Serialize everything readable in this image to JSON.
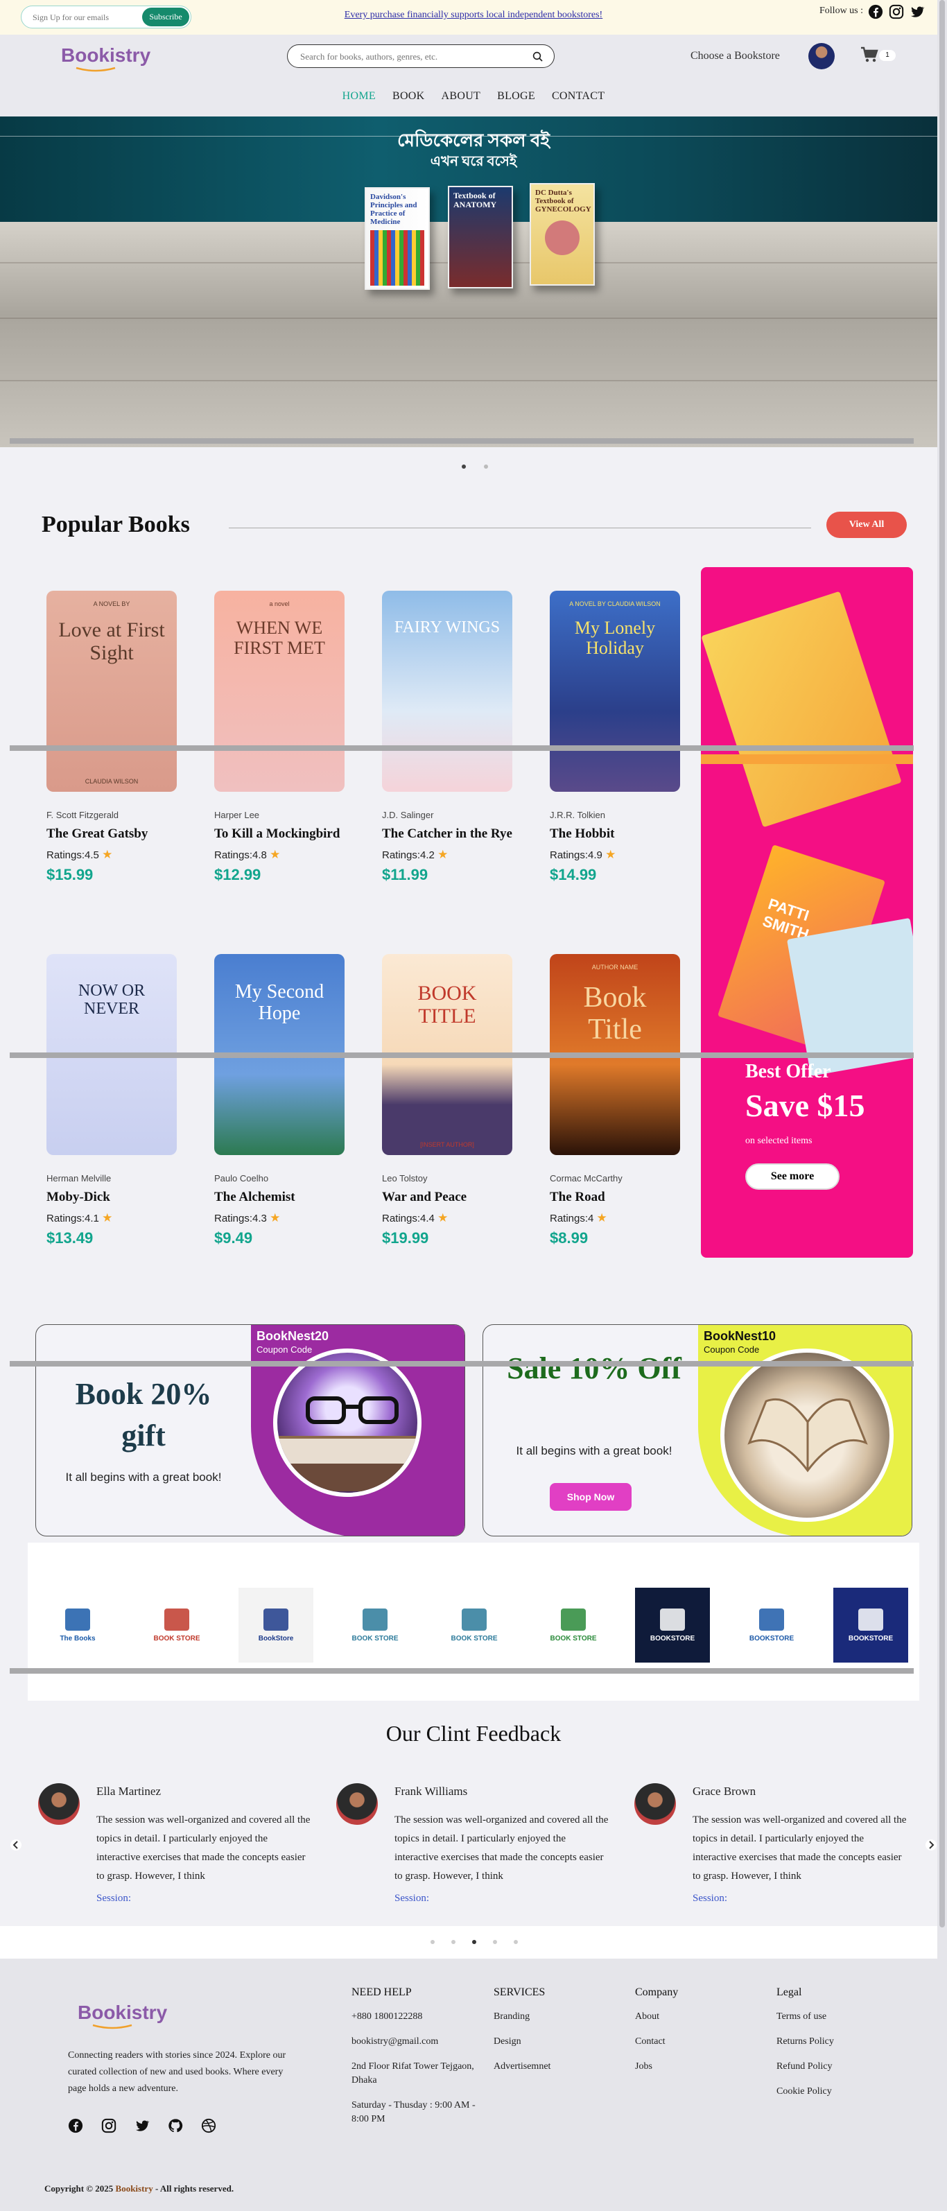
{
  "topbar": {
    "subscribe_placeholder": "Sign Up for our emails",
    "subscribe_button": "Subscribe",
    "promo": "Every purchase financially supports local independent bookstores!",
    "follow": "Follow us :"
  },
  "header": {
    "logo": "Bookistry",
    "search_placeholder": "Search for books, authors, genres, etc.",
    "choose_bookstore": "Choose a Bookstore",
    "cart_count": "1"
  },
  "nav": [
    "HOME",
    "BOOK",
    "ABOUT",
    "BLOGE",
    "CONTACT"
  ],
  "hero": {
    "line1": "মেডিকেলের সকল বই",
    "line2": "এখন ঘরে বসেই",
    "book_titles": [
      "Davidson's Principles and Practice of Medicine",
      "Textbook of ANATOMY",
      "DC Dutta's Textbook of GYNECOLOGY"
    ]
  },
  "popular": {
    "title": "Popular Books",
    "view_all": "View All",
    "rating_label": "Ratings:",
    "books": [
      {
        "author": "F. Scott Fitzgerald",
        "title": "The Great Gatsby",
        "rating": "4.5",
        "price": "$15.99",
        "cover_lines": [
          "A NOVEL BY",
          "Love at First Sight",
          "CLAUDIA WILSON"
        ]
      },
      {
        "author": "Harper Lee",
        "title": "To Kill a Mockingbird",
        "rating": "4.8",
        "price": "$12.99",
        "cover_lines": [
          "a novel",
          "WHEN WE FIRST MET",
          ""
        ]
      },
      {
        "author": "J.D. Salinger",
        "title": "The Catcher in the Rye",
        "rating": "4.2",
        "price": "$11.99",
        "cover_lines": [
          "",
          "FAIRY WINGS",
          ""
        ]
      },
      {
        "author": "J.R.R. Tolkien",
        "title": "The Hobbit",
        "rating": "4.9",
        "price": "$14.99",
        "cover_lines": [
          "A NOVEL BY CLAUDIA WILSON",
          "My Lonely Holiday",
          ""
        ]
      },
      {
        "author": "Herman Melville",
        "title": "Moby-Dick",
        "rating": "4.1",
        "price": "$13.49",
        "cover_lines": [
          "",
          "NOW OR NEVER",
          ""
        ]
      },
      {
        "author": "Paulo Coelho",
        "title": "The Alchemist",
        "rating": "4.3",
        "price": "$9.49",
        "cover_lines": [
          "",
          "My Second Hope",
          ""
        ]
      },
      {
        "author": "Leo Tolstoy",
        "title": "War and Peace",
        "rating": "4.4",
        "price": "$19.99",
        "cover_lines": [
          "",
          "BOOK TITLE",
          "[INSERT AUTHOR]"
        ]
      },
      {
        "author": "Cormac McCarthy",
        "title": "The Road",
        "rating": "4",
        "price": "$8.99",
        "cover_lines": [
          "AUTHOR NAME",
          "Book Title",
          ""
        ]
      }
    ]
  },
  "offer": {
    "label": "Best Offer",
    "amount": "Save $15",
    "note": "on selected items",
    "button": "See more",
    "book_text": [
      "PATTI SMITH"
    ]
  },
  "coupons": [
    {
      "headline": "Book 20% gift",
      "sub": "It all begins with a great book!",
      "code": "BookNest20",
      "code_label": "Coupon Code"
    },
    {
      "headline": "Sale 10% Off",
      "sub": "It all begins with a great book!",
      "code": "BookNest10",
      "code_label": "Coupon Code",
      "button": "Shop Now"
    }
  ],
  "brands": [
    "The Books",
    "BOOK STORE",
    "BookStore",
    "BOOK STORE",
    "BOOK STORE",
    "BOOK STORE",
    "BOOKSTORE",
    "BOOKSTORE",
    "BOOKSTORE"
  ],
  "feedback": {
    "title": "Our Clint Feedback",
    "items": [
      {
        "name": "Ella Martinez",
        "text": "The session was well-organized and covered all the topics in detail. I particularly enjoyed the interactive exercises that made the concepts easier to grasp. However, I think",
        "link": "Session:"
      },
      {
        "name": "Frank Williams",
        "text": "The session was well-organized and covered all the topics in detail. I particularly enjoyed the interactive exercises that made the concepts easier to grasp. However, I think",
        "link": "Session:"
      },
      {
        "name": "Grace Brown",
        "text": "The session was well-organized and covered all the topics in detail. I particularly enjoyed the interactive exercises that made the concepts easier to grasp. However, I think",
        "link": "Session:"
      }
    ]
  },
  "footer": {
    "logo": "Bookistry",
    "about": "Connecting readers with stories since 2024. Explore our curated collection of new and used books. Where every page holds a new adventure.",
    "columns": [
      {
        "head": "NEED HELP",
        "items": [
          "+880 1800122288",
          "bookistry@gmail.com",
          "2nd Floor Rifat Tower Tejgaon, Dhaka",
          "Saturday - Thusday : 9:00 AM - 8:00 PM"
        ]
      },
      {
        "head": "SERVICES",
        "items": [
          "Branding",
          "Design",
          "Advertisemnet"
        ]
      },
      {
        "head": "Company",
        "items": [
          "About",
          "Contact",
          "Jobs"
        ]
      },
      {
        "head": "Legal",
        "items": [
          "Terms of use",
          "Returns Policy",
          "Refund Policy",
          "Cookie Policy"
        ]
      }
    ],
    "copyright_prefix": "Copyright © 2025",
    "copyright_brand": "Bookistry",
    "copyright_suffix": "- All rights reserved."
  },
  "colors": {
    "accent": "#12a58d",
    "offer": "#f40f84",
    "view_all": "#e8534a",
    "brand_purple": "#8b5aa8"
  },
  "icons": [
    "facebook-icon",
    "instagram-icon",
    "twitter-icon",
    "search-icon",
    "cart-icon",
    "github-icon",
    "dribbble-icon"
  ]
}
